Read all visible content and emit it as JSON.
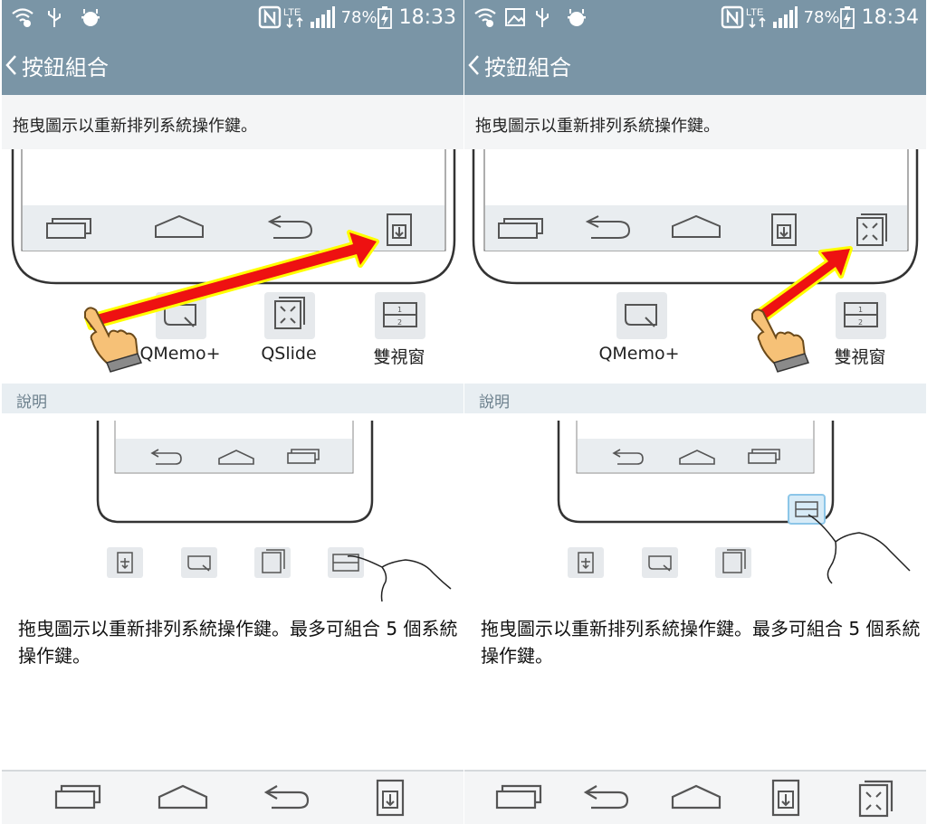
{
  "panels": [
    {
      "status": {
        "battery_pct": "78%",
        "time": "18:33"
      },
      "title": "按鈕組合",
      "instruction": "拖曳圖示以重新排列系統操作鍵。",
      "available_icons": {
        "qmemo": "QMemo+",
        "qslide": "QSlide",
        "dual": "雙視窗"
      },
      "section_header": "說明",
      "description": "拖曳圖示以重新排列系統操作鍵。最多可組合 5 個系統操作鍵。",
      "navbar": [
        "recent-apps-icon",
        "home-icon",
        "back-icon",
        "notification-icon"
      ]
    },
    {
      "status": {
        "battery_pct": "78%",
        "time": "18:34"
      },
      "title": "按鈕組合",
      "instruction": "拖曳圖示以重新排列系統操作鍵。",
      "available_icons": {
        "qmemo": "QMemo+",
        "dual": "雙視窗"
      },
      "section_header": "說明",
      "description": "拖曳圖示以重新排列系統操作鍵。最多可組合 5 個系統操作鍵。",
      "navbar": [
        "recent-apps-icon",
        "back-icon",
        "home-icon",
        "notification-icon",
        "qslide-icon"
      ]
    }
  ],
  "colors": {
    "header": "#7a95a6",
    "arrow_fill": "#ee1111",
    "arrow_outline": "#ffff00",
    "section_bg": "#e8eef2"
  }
}
